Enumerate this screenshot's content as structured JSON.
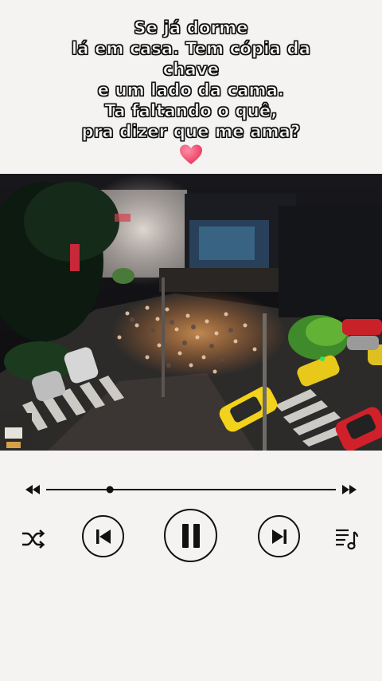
{
  "lyrics": {
    "lines": [
      "Se já dorme",
      "lá em casa.  Tem cópia da",
      "chave",
      "e um lado da cama.",
      "Ta faltando o quê,",
      "pra dizer que me ama?"
    ],
    "emoji": "heart-emoji"
  },
  "video": {
    "description_icon": "city-night-crowd-video"
  },
  "player": {
    "progress": 0.22,
    "icons": {
      "rewind": "rewind-icon",
      "fast_forward": "fast-forward-icon",
      "shuffle": "shuffle-icon",
      "previous": "previous-track-icon",
      "pause": "pause-icon",
      "next": "next-track-icon",
      "playlist": "playlist-icon"
    }
  },
  "colors": {
    "background": "#f4f3f1",
    "controls": "#111111",
    "heart": "#f0506e"
  }
}
